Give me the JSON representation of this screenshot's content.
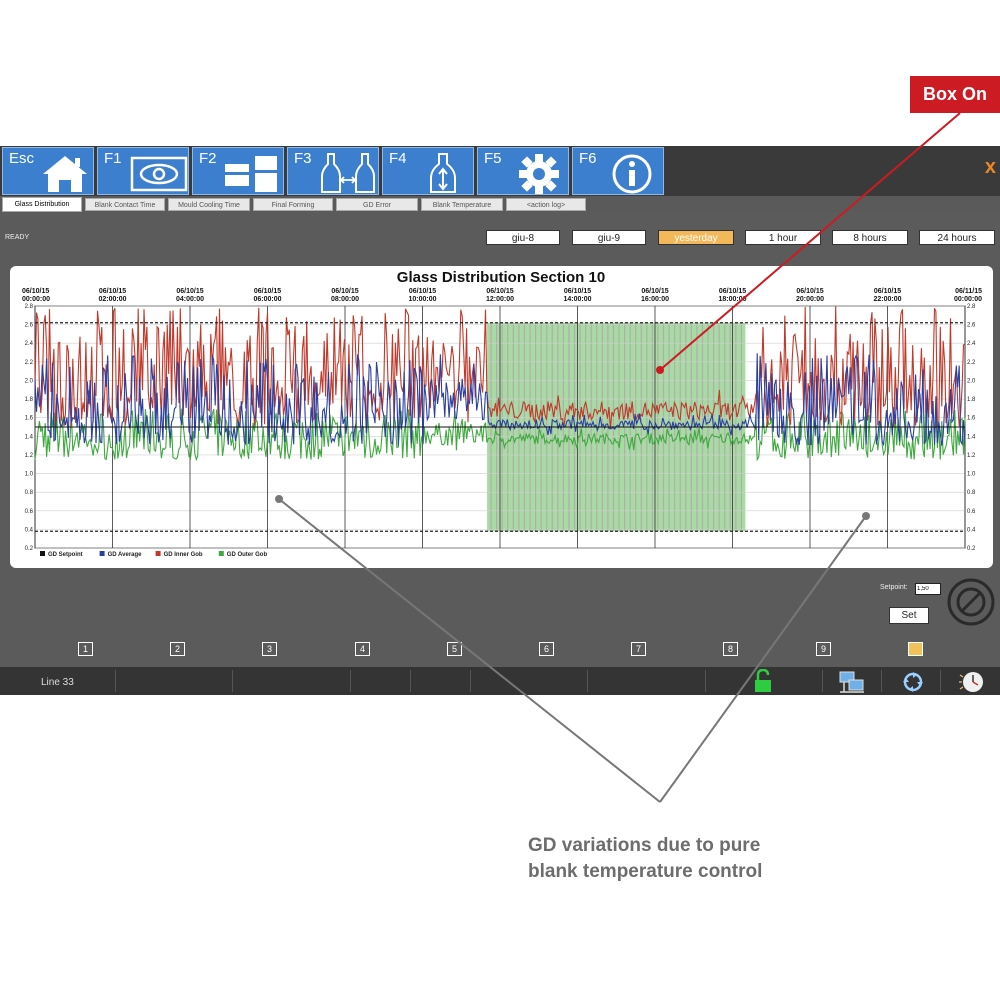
{
  "toolbar": {
    "keys": [
      {
        "label": "Esc",
        "icon": "home-icon"
      },
      {
        "label": "F1",
        "icon": "eye-icon"
      },
      {
        "label": "F2",
        "icon": "molds-icon"
      },
      {
        "label": "F3",
        "icon": "bottles-swap-icon"
      },
      {
        "label": "F4",
        "icon": "bottle-arrows-icon"
      },
      {
        "label": "F5",
        "icon": "gear-icon"
      },
      {
        "label": "F6",
        "icon": "info-icon"
      }
    ],
    "close_label": "x"
  },
  "tabs": [
    "Glass Distribution",
    "Blank Contact Time",
    "Mould Cooling Time",
    "Final Forming",
    "GD Error",
    "Blank Temperature",
    "<action log>"
  ],
  "status": "READY",
  "range_buttons": [
    "giu-8",
    "giu-9",
    "yesterday",
    "1 hour",
    "8 hours",
    "24 hours"
  ],
  "selected_range": "yesterday",
  "chart_data": {
    "type": "line",
    "title": "Glass Distribution Section 10",
    "x_ticks": [
      {
        "date": "06/10/15",
        "time": "00:00:00"
      },
      {
        "date": "06/10/15",
        "time": "02:00:00"
      },
      {
        "date": "06/10/15",
        "time": "04:00:00"
      },
      {
        "date": "06/10/15",
        "time": "06:00:00"
      },
      {
        "date": "06/10/15",
        "time": "08:00:00"
      },
      {
        "date": "06/10/15",
        "time": "10:00:00"
      },
      {
        "date": "06/10/15",
        "time": "12:00:00"
      },
      {
        "date": "06/10/15",
        "time": "14:00:00"
      },
      {
        "date": "06/10/15",
        "time": "16:00:00"
      },
      {
        "date": "06/10/15",
        "time": "18:00:00"
      },
      {
        "date": "06/10/15",
        "time": "20:00:00"
      },
      {
        "date": "06/10/15",
        "time": "22:00:00"
      },
      {
        "date": "06/11/15",
        "time": "00:00:00"
      }
    ],
    "y_ticks": [
      "0.2",
      "0.4",
      "0.6",
      "0.8",
      "1.0",
      "1.2",
      "1.4",
      "1.6",
      "1.8",
      "2.0",
      "2.2",
      "2.4",
      "2.6",
      "2.8"
    ],
    "ylim": [
      0.2,
      2.8
    ],
    "limit_lines": [
      2.62,
      0.38
    ],
    "setpoint": 1.5,
    "highlight_region": {
      "from": "11:40",
      "to": "18:20"
    },
    "series": [
      {
        "name": "GD Setpoint",
        "color": "#111111",
        "value": 1.5
      },
      {
        "name": "GD Average",
        "color": "#2b3fa0",
        "normal_range": [
          1.3,
          2.3
        ],
        "boxon_range": [
          1.4,
          1.65
        ]
      },
      {
        "name": "GD Inner Gob",
        "color": "#c0392b",
        "normal_range": [
          1.5,
          2.8
        ],
        "boxon_range": [
          1.45,
          1.9
        ]
      },
      {
        "name": "GD Outer Gob",
        "color": "#3fa83f",
        "normal_range": [
          1.15,
          1.7
        ],
        "boxon_range": [
          1.25,
          1.5
        ]
      }
    ],
    "legend_position": "bottom-left"
  },
  "setpoint": {
    "label": "Setpoint:",
    "value": "1,50",
    "button": "Set"
  },
  "sections": [
    "1",
    "2",
    "3",
    "4",
    "5",
    "6",
    "7",
    "8",
    "9",
    "10"
  ],
  "selected_section": "10",
  "statusbar": {
    "line_label": "Line 33"
  },
  "annotations": {
    "box_on": "Box On",
    "caption_line1": "GD variations due to pure",
    "caption_line2": "blank  temperature control"
  },
  "colors": {
    "fkey": "#3c7fcf",
    "panel": "#5b5b5b",
    "accent": "#f3b85a",
    "box_on": "#cc1b22",
    "highlight": "#9ed69a"
  }
}
